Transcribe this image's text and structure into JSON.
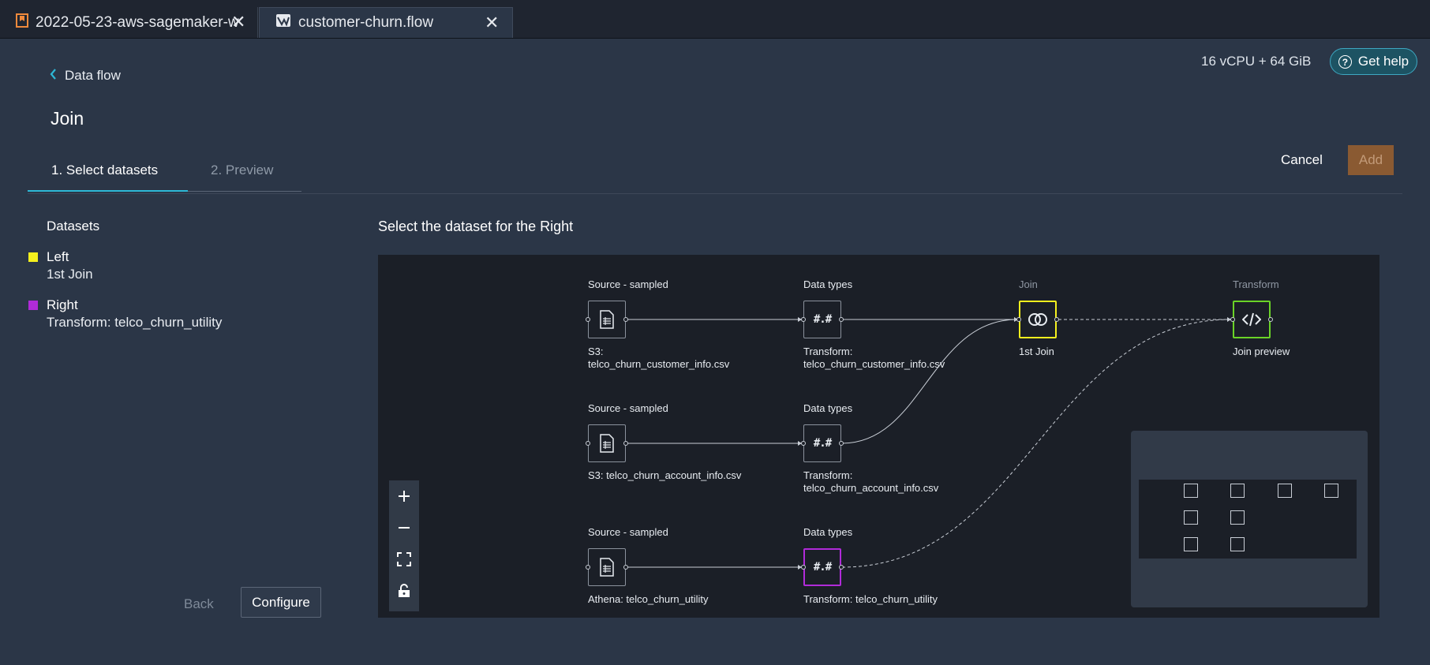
{
  "tabs": [
    {
      "label": "2022-05-23-aws-sagemaker-w",
      "icon": "bookmark-icon"
    },
    {
      "label": "customer-churn.flow",
      "icon": "flow-icon"
    }
  ],
  "header": {
    "back_label": "Data flow",
    "title": "Join",
    "compute": "16 vCPU + 64 GiB",
    "help_label": "Get help",
    "cancel_label": "Cancel",
    "add_label": "Add"
  },
  "steps": {
    "step1": "1. Select datasets",
    "step2": "2. Preview"
  },
  "datasets_panel": {
    "heading": "Datasets",
    "items": [
      {
        "name": "Left",
        "value": "1st Join",
        "color": "#f5f01e"
      },
      {
        "name": "Right",
        "value": "Transform: telco_churn_utility",
        "color": "#b12bd9"
      }
    ],
    "back_label": "Back",
    "configure_label": "Configure"
  },
  "canvas": {
    "instruction": "Select the dataset for the Right",
    "colors": {
      "left_highlight": "#f5f01e",
      "right_highlight": "#b12bd9",
      "preview_highlight": "#6ad327"
    },
    "rows": [
      {
        "source_label": "Source - sampled",
        "source_name": "S3:\ntelco_churn_customer_info.csv",
        "types_label": "Data types",
        "types_name": "Transform:\ntelco_churn_customer_info.csv"
      },
      {
        "source_label": "Source - sampled",
        "source_name": "S3: telco_churn_account_info.csv",
        "types_label": "Data types",
        "types_name": "Transform:\ntelco_churn_account_info.csv"
      },
      {
        "source_label": "Source - sampled",
        "source_name": "Athena: telco_churn_utility",
        "types_label": "Data types",
        "types_name": "Transform: telco_churn_utility"
      }
    ],
    "node_glyph": "#.#",
    "join": {
      "label": "Join",
      "name": "1st Join"
    },
    "transform": {
      "label": "Transform",
      "name": "Join preview"
    }
  }
}
